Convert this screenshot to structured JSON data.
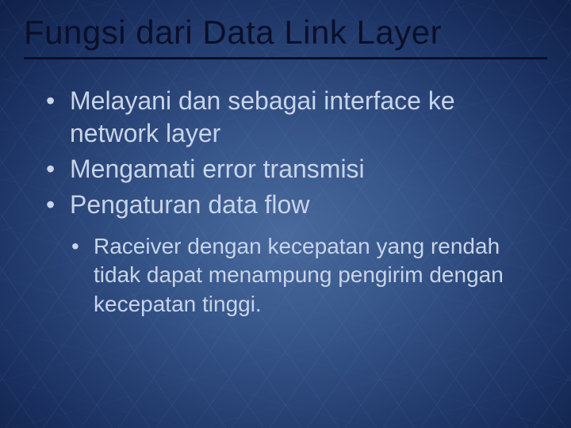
{
  "slide": {
    "title": "Fungsi dari  Data Link Layer",
    "bullets": [
      {
        "text": "Melayani dan sebagai interface ke network layer"
      },
      {
        "text": "Mengamati error transmisi"
      },
      {
        "text": "Pengaturan data flow"
      }
    ],
    "subBullets": [
      {
        "text": "Raceiver dengan kecepatan yang rendah tidak dapat menampung pengirim dengan kecepatan tinggi."
      }
    ]
  }
}
